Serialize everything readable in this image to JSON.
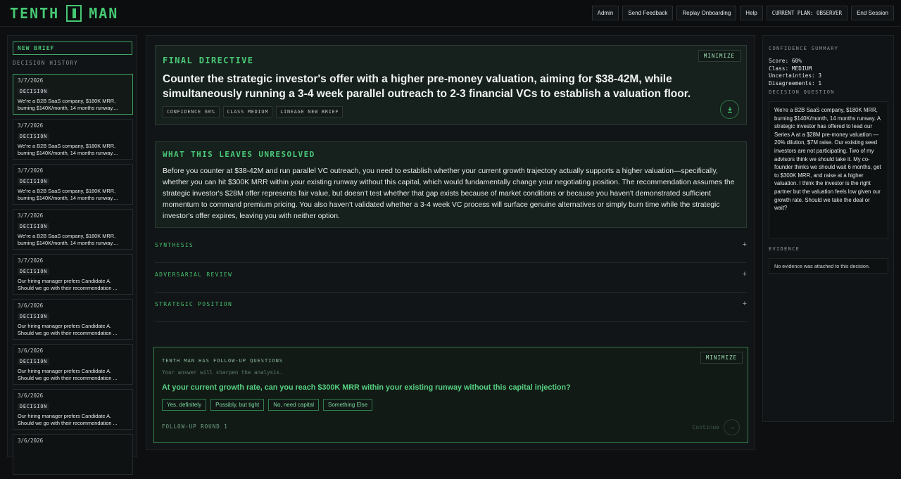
{
  "app": {
    "logo_left": "TENTH",
    "logo_right": "MAN"
  },
  "nav": {
    "admin": "Admin",
    "feedback": "Send Feedback",
    "replay": "Replay Onboarding",
    "help": "Help",
    "plan": "CURRENT PLAN: OBSERVER",
    "end": "End Session"
  },
  "sidebar": {
    "new_brief": "NEW BRIEF",
    "history_title": "DECISION HISTORY",
    "items": [
      {
        "date": "3/7/2026",
        "tag": "DECISION",
        "text": "We're a B2B SaaS company, $180K MRR,\nburning $140K/month, 14 months runway...."
      },
      {
        "date": "3/7/2026",
        "tag": "DECISION",
        "text": "We're a B2B SaaS company, $180K MRR,\nburning $140K/month, 14 months runway...."
      },
      {
        "date": "3/7/2026",
        "tag": "DECISION",
        "text": "We're a B2B SaaS company, $180K MRR,\nburning $140K/month, 14 months runway...."
      },
      {
        "date": "3/7/2026",
        "tag": "DECISION",
        "text": "We're a B2B SaaS company, $180K MRR,\nburning $140K/month, 14 months runway...."
      },
      {
        "date": "3/7/2026",
        "tag": "DECISION",
        "text": "Our hiring manager prefers Candidate A.\nShould we go with their recommendation ..."
      },
      {
        "date": "3/6/2026",
        "tag": "DECISION",
        "text": "Our hiring manager prefers Candidate A.\nShould we go with their recommendation ..."
      },
      {
        "date": "3/6/2026",
        "tag": "DECISION",
        "text": "Our hiring manager prefers Candidate A.\nShould we go with their recommendation ..."
      },
      {
        "date": "3/6/2026",
        "tag": "DECISION",
        "text": "Our hiring manager prefers Candidate A.\nShould we go with their recommendation ..."
      },
      {
        "date": "3/6/2026",
        "tag": "",
        "text": ""
      }
    ]
  },
  "directive": {
    "title": "FINAL DIRECTIVE",
    "minimize": "MINIMIZE",
    "text": "Counter the strategic investor's offer with a higher pre-money valuation, aiming for $38-42M, while simultaneously running a 3-4 week parallel outreach to 2-3 financial VCs to establish a valuation floor.",
    "confidence": "CONFIDENCE 60%",
    "class": "CLASS MEDIUM",
    "lineage": "LINEAGE NEW BRIEF"
  },
  "unresolved": {
    "title": "WHAT THIS LEAVES UNRESOLVED",
    "text": "Before you counter at $38-42M and run parallel VC outreach, you need to establish whether your current growth trajectory actually supports a higher valuation—specifically, whether you can hit $300K MRR within your existing runway without this capital, which would fundamentally change your negotiating position. The recommendation assumes the strategic investor's $28M offer represents fair value, but doesn't test whether that gap exists because of market conditions or because you haven't demonstrated sufficient momentum to command premium pricing. You also haven't validated whether a 3-4 week VC process will surface genuine alternatives or simply burn time while the strategic investor's offer expires, leaving you with neither option."
  },
  "sections": [
    {
      "label": "SYNTHESIS",
      "icon": "+"
    },
    {
      "label": "ADVERSARIAL REVIEW",
      "icon": "+"
    },
    {
      "label": "STRATEGIC POSITION",
      "icon": "+"
    }
  ],
  "followup": {
    "title": "TENTH MAN HAS FOLLOW-UP QUESTIONS",
    "subtitle": "Your answer will sharpen the analysis.",
    "minimize": "MINIMIZE",
    "question": "At your current growth rate, can you reach $300K MRR within your existing runway without this capital injection?",
    "options": [
      "Yes, definitely",
      "Possibly, but tight",
      "No, need capital",
      "Something Else"
    ],
    "round": "FOLLOW-UP ROUND 1",
    "continue": "Continue",
    "arrow": "→"
  },
  "right": {
    "summary_title": "CONFIDENCE SUMMARY",
    "score": "Score: 60%",
    "class": "Class: MEDIUM",
    "uncertainties": "Uncertainties: 3",
    "disagreements": "Disagreements: 1",
    "question_title": "DECISION QUESTION",
    "question": "We're a B2B SaaS company, $180K MRR, burning $140K/month, 14 months runway. A strategic investor has offered to lead our Series A at a $28M pre-money valuation — 20% dilution, $7M raise. Our existing seed investors are not participating. Two of my advisors think we should take it. My co-founder thinks we should wait 6 months, get to $300K MRR, and raise at a higher valuation. I think the investor is the right partner but the valuation feels low given our growth rate. Should we take the deal or wait?",
    "evidence_title": "EVIDENCE",
    "evidence": "No evidence was attached to this decision."
  },
  "colors": {
    "accent": "#46c873",
    "background": "#0d0f10",
    "panel": "#121517"
  }
}
